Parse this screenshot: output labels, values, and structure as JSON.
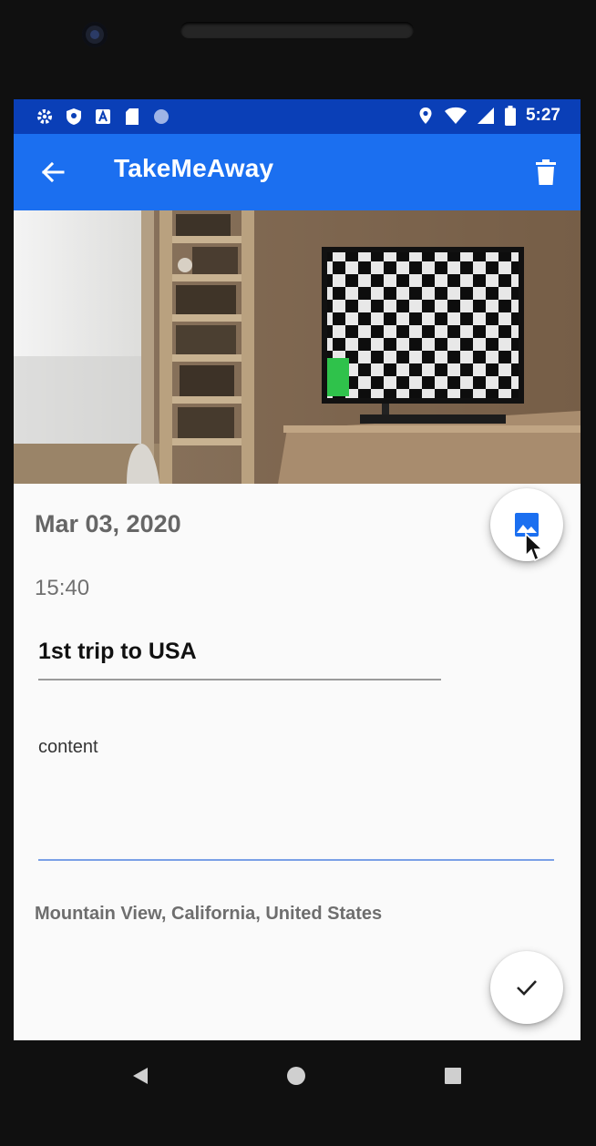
{
  "status_bar": {
    "time": "5:27",
    "left_icons": [
      "settings-icon",
      "shield-icon",
      "app-a-icon",
      "sd-card-icon",
      "sync-circle-icon"
    ],
    "right_icons": [
      "location-pin-icon",
      "wifi-icon",
      "signal-icon",
      "battery-icon"
    ]
  },
  "app_bar": {
    "title": "TakeMeAway",
    "back_icon": "arrow-left-icon",
    "delete_icon": "trash-icon"
  },
  "entry": {
    "date": "Mar 03, 2020",
    "time": "15:40",
    "title_value": "1st trip to USA",
    "content_placeholder": "content",
    "location": "Mountain View, California, United States"
  },
  "fabs": {
    "change_image_icon": "image-icon",
    "save_icon": "check-icon"
  },
  "nav": [
    "back-triangle-icon",
    "home-circle-icon",
    "recents-square-icon"
  ],
  "colors": {
    "status_bar": "#0a3fb7",
    "app_bar": "#1b6ff0",
    "accent_fab_icon": "#1b6ff0",
    "content_underline": "#7aa0e6"
  }
}
